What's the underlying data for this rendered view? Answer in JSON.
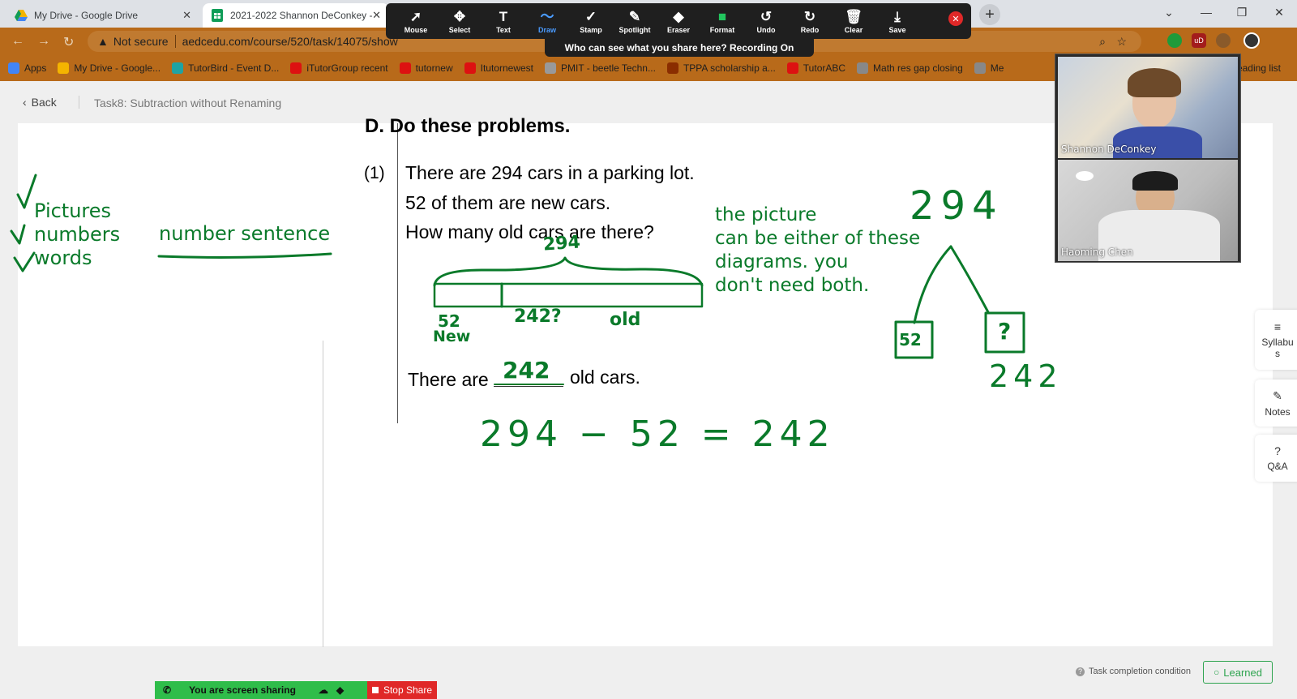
{
  "tabs": [
    {
      "title": "My Drive - Google Drive",
      "icon": "google-drive-icon"
    },
    {
      "title": "2021-2022 Shannon DeConkey -",
      "icon": "google-sheets-icon"
    }
  ],
  "address": {
    "security": "Not secure",
    "url": "aedcedu.com/course/520/task/14075/show"
  },
  "bookmarks": [
    {
      "label": "Apps",
      "color": "#4285f4"
    },
    {
      "label": "My Drive - Google...",
      "color": "#f4b400"
    },
    {
      "label": "TutorBird - Event D...",
      "color": "#1fa3a3"
    },
    {
      "label": "iTutorGroup recent",
      "color": "#d11"
    },
    {
      "label": "tutornew",
      "color": "#d11"
    },
    {
      "label": "Itutornewest",
      "color": "#d11"
    },
    {
      "label": "PMIT - beetle Techn...",
      "color": "#999"
    },
    {
      "label": "TPPA scholarship a...",
      "color": "#8a2d00"
    },
    {
      "label": "TutorABC",
      "color": "#d11"
    },
    {
      "label": "Math res gap closing",
      "color": "#888"
    },
    {
      "label": "Me",
      "color": "#888"
    }
  ],
  "bookmark_overflow": "eading list",
  "zoom_toolbar": {
    "tools": [
      {
        "label": "Mouse",
        "glyph": "➚"
      },
      {
        "label": "Select",
        "glyph": "✥"
      },
      {
        "label": "Text",
        "glyph": "T"
      },
      {
        "label": "Draw",
        "glyph": "〜"
      },
      {
        "label": "Stamp",
        "glyph": "✓"
      },
      {
        "label": "Spotlight",
        "glyph": "✎"
      },
      {
        "label": "Eraser",
        "glyph": "◆"
      },
      {
        "label": "Format",
        "glyph": "■"
      },
      {
        "label": "Undo",
        "glyph": "↺"
      },
      {
        "label": "Redo",
        "glyph": "↻"
      },
      {
        "label": "Clear",
        "glyph": "🗑"
      },
      {
        "label": "Save",
        "glyph": "⤓"
      }
    ],
    "active": "Draw",
    "share_notice": "Who can see what you share here? Recording On"
  },
  "page": {
    "back_label": "Back",
    "task_title": "Task8:  Subtraction without Renaming"
  },
  "worksheet": {
    "heading": "D.   Do these problems.",
    "num": "(1)",
    "line1": "There are 294 cars in a parking lot.",
    "line2": "52 of them are new cars.",
    "line3": "How many old cars are there?",
    "answer_pre": "There are",
    "answer_post": "old cars."
  },
  "annotations": {
    "pictures": "Pictures",
    "numbers": "numbers",
    "words": "words",
    "number_sentence": "number sentence",
    "bar_total": "294",
    "bar_left": "52",
    "bar_left_label": "New",
    "bar_right": "242?",
    "bar_right_label": "old",
    "answer": "242",
    "note_lines": [
      "the picture",
      "can be either of these",
      "diagrams.  you",
      "don't need both."
    ],
    "tree_top": "294",
    "tree_left": "52",
    "tree_right": "?",
    "tree_result": "242",
    "equation": "294 − 52 = 242"
  },
  "sidebar": [
    {
      "label": "Syllabus",
      "icon": "list-icon"
    },
    {
      "label": "Notes",
      "icon": "pencil-icon"
    },
    {
      "label": "Q&A",
      "icon": "question-icon"
    }
  ],
  "participants": [
    {
      "name": "Shannon DeConkey"
    },
    {
      "name": "Haoming Chen"
    }
  ],
  "footer": {
    "sharing": "You are screen sharing",
    "stop": "Stop Share",
    "task_condition": "Task completion condition",
    "learned": "Learned"
  }
}
